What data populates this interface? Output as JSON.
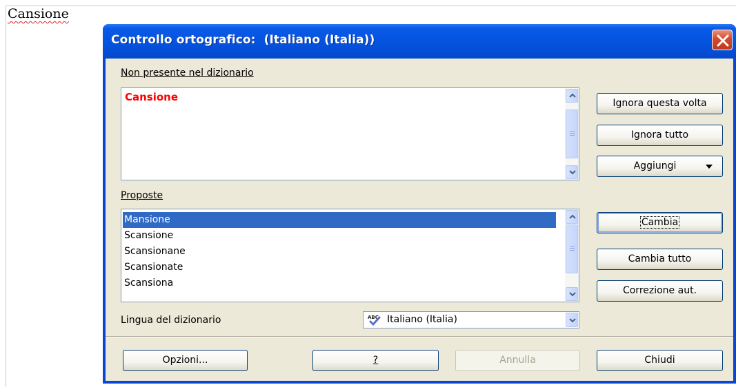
{
  "document": {
    "word": "Cansione"
  },
  "dialog": {
    "title": "Controllo ortografico:  (Italiano (Italia))",
    "not_in_dictionary_label": "Non presente nel dizionario",
    "unknown_word": "Cansione",
    "suggestions_label": "Proposte",
    "suggestions": [
      "Mansione",
      "Scansione",
      "Scansionane",
      "Scansionate",
      "Scansiona"
    ],
    "selected_suggestion": "Mansione",
    "language_label": "Lingua del dizionario",
    "language_value": "Italiano (Italia)",
    "buttons": {
      "ignore_once": "Ignora questa volta",
      "ignore_all": "Ignora tutto",
      "add": "Aggiungi",
      "change": "Cambia",
      "change_all": "Cambia tutto",
      "autocorrect": "Correzione aut.",
      "options": "Opzioni...",
      "help": "?",
      "undo": "Annulla",
      "close": "Chiudi"
    },
    "colors": {
      "title_bar": "#0553df",
      "client_bg": "#ece9d8",
      "unknown_word": "#ff0000",
      "selection": "#316ac5"
    },
    "icons": [
      "close-icon",
      "scroll-up-icon",
      "scroll-down-icon",
      "dropdown-arrow-icon",
      "spellcheck-abc-icon"
    ]
  }
}
